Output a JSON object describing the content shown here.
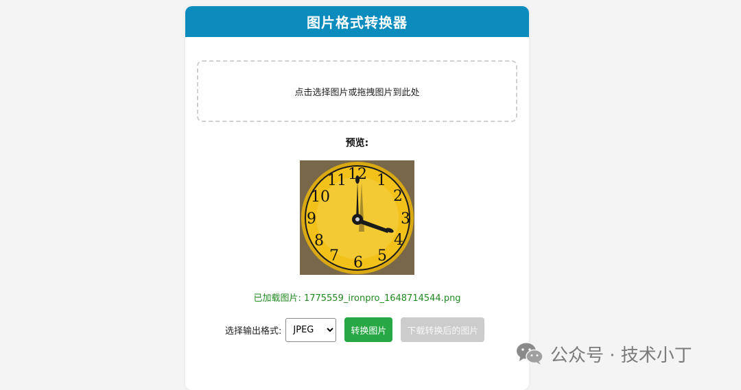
{
  "app": {
    "title": "图片格式转换器"
  },
  "dropzone": {
    "text": "点击选择图片或拖拽图片到此处"
  },
  "preview": {
    "label": "预览:",
    "numbers": [
      "12",
      "1",
      "2",
      "3",
      "4",
      "5",
      "6",
      "7",
      "8",
      "9",
      "10",
      "11"
    ]
  },
  "status": {
    "text": "已加载图片: 1775559_ironpro_1648714544.png"
  },
  "controls": {
    "format_label": "选择输出格式:",
    "format_selected": "JPEG",
    "convert_label": "转换图片",
    "download_label": "下载转换后的图片"
  },
  "watermark": {
    "text": "公众号 · 技术小丁",
    "icon": "wechat-icon"
  },
  "colors": {
    "header": "#0b8cbd",
    "convert_button": "#28a745",
    "download_button_disabled": "#cccccc",
    "status_text": "#1f8a1f",
    "clock_face": "#f2c21a"
  }
}
